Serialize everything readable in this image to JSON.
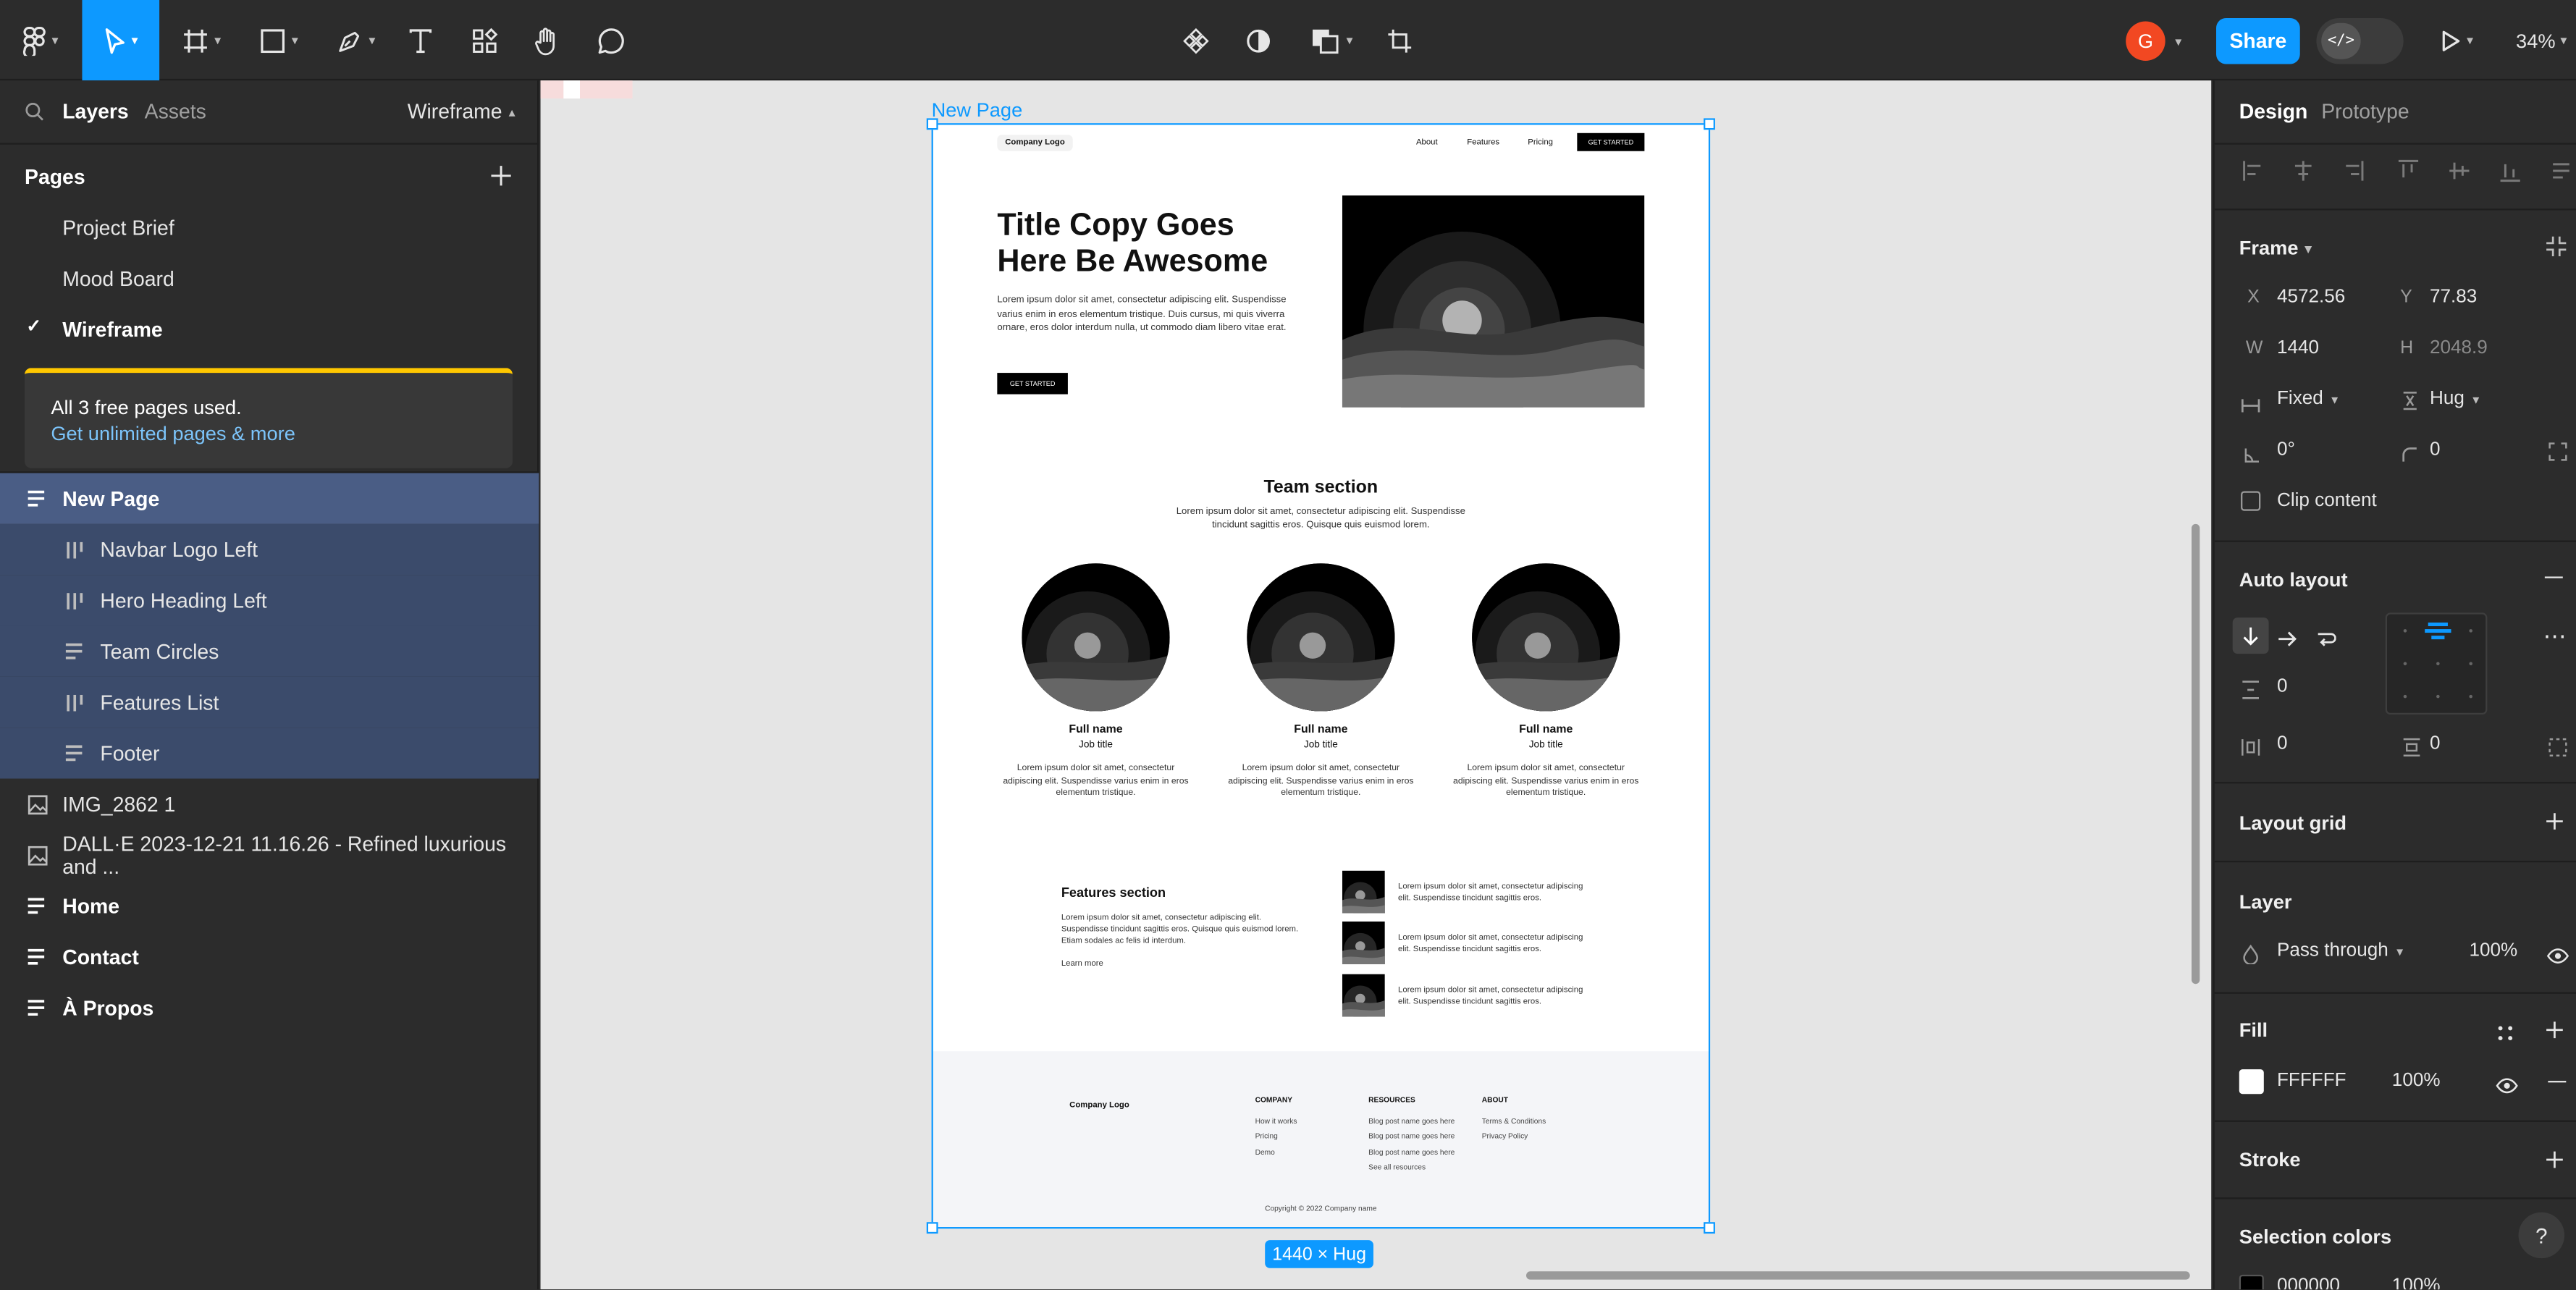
{
  "toolbar": {
    "share_label": "Share",
    "zoom": "34%",
    "avatar_initial": "G",
    "dev_mode_label": "</>"
  },
  "left_panel": {
    "tabs": {
      "layers": "Layers",
      "assets": "Assets"
    },
    "page_dropdown": "Wireframe",
    "pages_heading": "Pages",
    "pages": [
      {
        "label": "Project Brief"
      },
      {
        "label": "Mood Board"
      },
      {
        "label": "Wireframe"
      }
    ],
    "notice": {
      "text": "All 3 free pages used.",
      "link": "Get unlimited pages & more"
    },
    "layers": [
      {
        "label": "New Page"
      },
      {
        "label": "Navbar Logo Left"
      },
      {
        "label": "Hero Heading Left"
      },
      {
        "label": "Team Circles"
      },
      {
        "label": "Features List"
      },
      {
        "label": "Footer"
      },
      {
        "label": "IMG_2862 1"
      },
      {
        "label": "DALL·E 2023-12-21 11.16.26 - Refined luxurious and ..."
      },
      {
        "label": "Home"
      },
      {
        "label": "Contact"
      },
      {
        "label": "À Propos"
      }
    ]
  },
  "canvas": {
    "frame_label": "New Page",
    "size_badge": "1440 × Hug",
    "page": {
      "nav": {
        "logo": "Company Logo",
        "links": [
          "About",
          "Features",
          "Pricing"
        ],
        "cta": "GET STARTED"
      },
      "hero": {
        "title": "Title Copy Goes Here Be Awesome",
        "body": "Lorem ipsum dolor sit amet, consectetur adipiscing elit. Suspendisse varius enim in eros elementum tristique. Duis cursus, mi quis viverra ornare, eros dolor interdum nulla, ut commodo diam libero vitae erat.",
        "cta": "GET STARTED"
      },
      "team": {
        "heading": "Team section",
        "body": "Lorem ipsum dolor sit amet, consectetur adipiscing elit. Suspendisse tincidunt sagittis eros. Quisque quis euismod lorem.",
        "members": [
          {
            "name": "Full name",
            "title": "Job title",
            "bio": "Lorem ipsum dolor sit amet, consectetur adipiscing elit. Suspendisse varius enim in eros elementum tristique."
          },
          {
            "name": "Full name",
            "title": "Job title",
            "bio": "Lorem ipsum dolor sit amet, consectetur adipiscing elit. Suspendisse varius enim in eros elementum tristique."
          },
          {
            "name": "Full name",
            "title": "Job title",
            "bio": "Lorem ipsum dolor sit amet, consectetur adipiscing elit. Suspendisse varius enim in eros elementum tristique."
          }
        ]
      },
      "features": {
        "heading": "Features section",
        "body": "Lorem ipsum dolor sit amet, consectetur adipiscing elit. Suspendisse tincidunt sagittis eros. Quisque quis euismod lorem. Etiam sodales ac felis id interdum.",
        "link": "Learn more",
        "items": [
          {
            "text": "Lorem ipsum dolor sit amet, consectetur adipiscing elit. Suspendisse tincidunt sagittis eros."
          },
          {
            "text": "Lorem ipsum dolor sit amet, consectetur adipiscing elit. Suspendisse tincidunt sagittis eros."
          },
          {
            "text": "Lorem ipsum dolor sit amet, consectetur adipiscing elit. Suspendisse tincidunt sagittis eros."
          }
        ]
      },
      "footer": {
        "logo": "Company Logo",
        "columns": [
          {
            "heading": "COMPANY",
            "links": [
              "How it works",
              "Pricing",
              "Demo"
            ]
          },
          {
            "heading": "RESOURCES",
            "links": [
              "Blog post name goes here",
              "Blog post name goes here",
              "Blog post name goes here",
              "See all resources"
            ]
          },
          {
            "heading": "ABOUT",
            "links": [
              "Terms & Conditions",
              "Privacy Policy"
            ]
          }
        ],
        "copyright": "Copyright © 2022 Company name"
      }
    }
  },
  "right_panel": {
    "tabs": {
      "design": "Design",
      "prototype": "Prototype"
    },
    "frame": {
      "heading": "Frame",
      "x_label": "X",
      "x": "4572.56",
      "y_label": "Y",
      "y": "77.83",
      "w_label": "W",
      "w": "1440",
      "h_label": "H",
      "h": "2048.9",
      "width_mode": "Fixed",
      "height_mode": "Hug",
      "rotation": "0°",
      "radius": "0",
      "clip_content": "Clip content"
    },
    "auto_layout": {
      "heading": "Auto layout",
      "gap": "0",
      "padding_h": "0",
      "padding_v": "0"
    },
    "layout_grid": {
      "heading": "Layout grid"
    },
    "layer": {
      "heading": "Layer",
      "blend": "Pass through",
      "opacity": "100%"
    },
    "fill": {
      "heading": "Fill",
      "hex": "FFFFFF",
      "opacity": "100%"
    },
    "stroke": {
      "heading": "Stroke"
    },
    "selection_colors": {
      "heading": "Selection colors",
      "hex": "000000",
      "opacity": "100%"
    }
  },
  "colors": {
    "accent": "#0d99ff",
    "share_bg": "#0d99ff",
    "avatar": "#f24822",
    "layer_selected": "#3b4b6b",
    "notice_border": "#ffc700"
  }
}
